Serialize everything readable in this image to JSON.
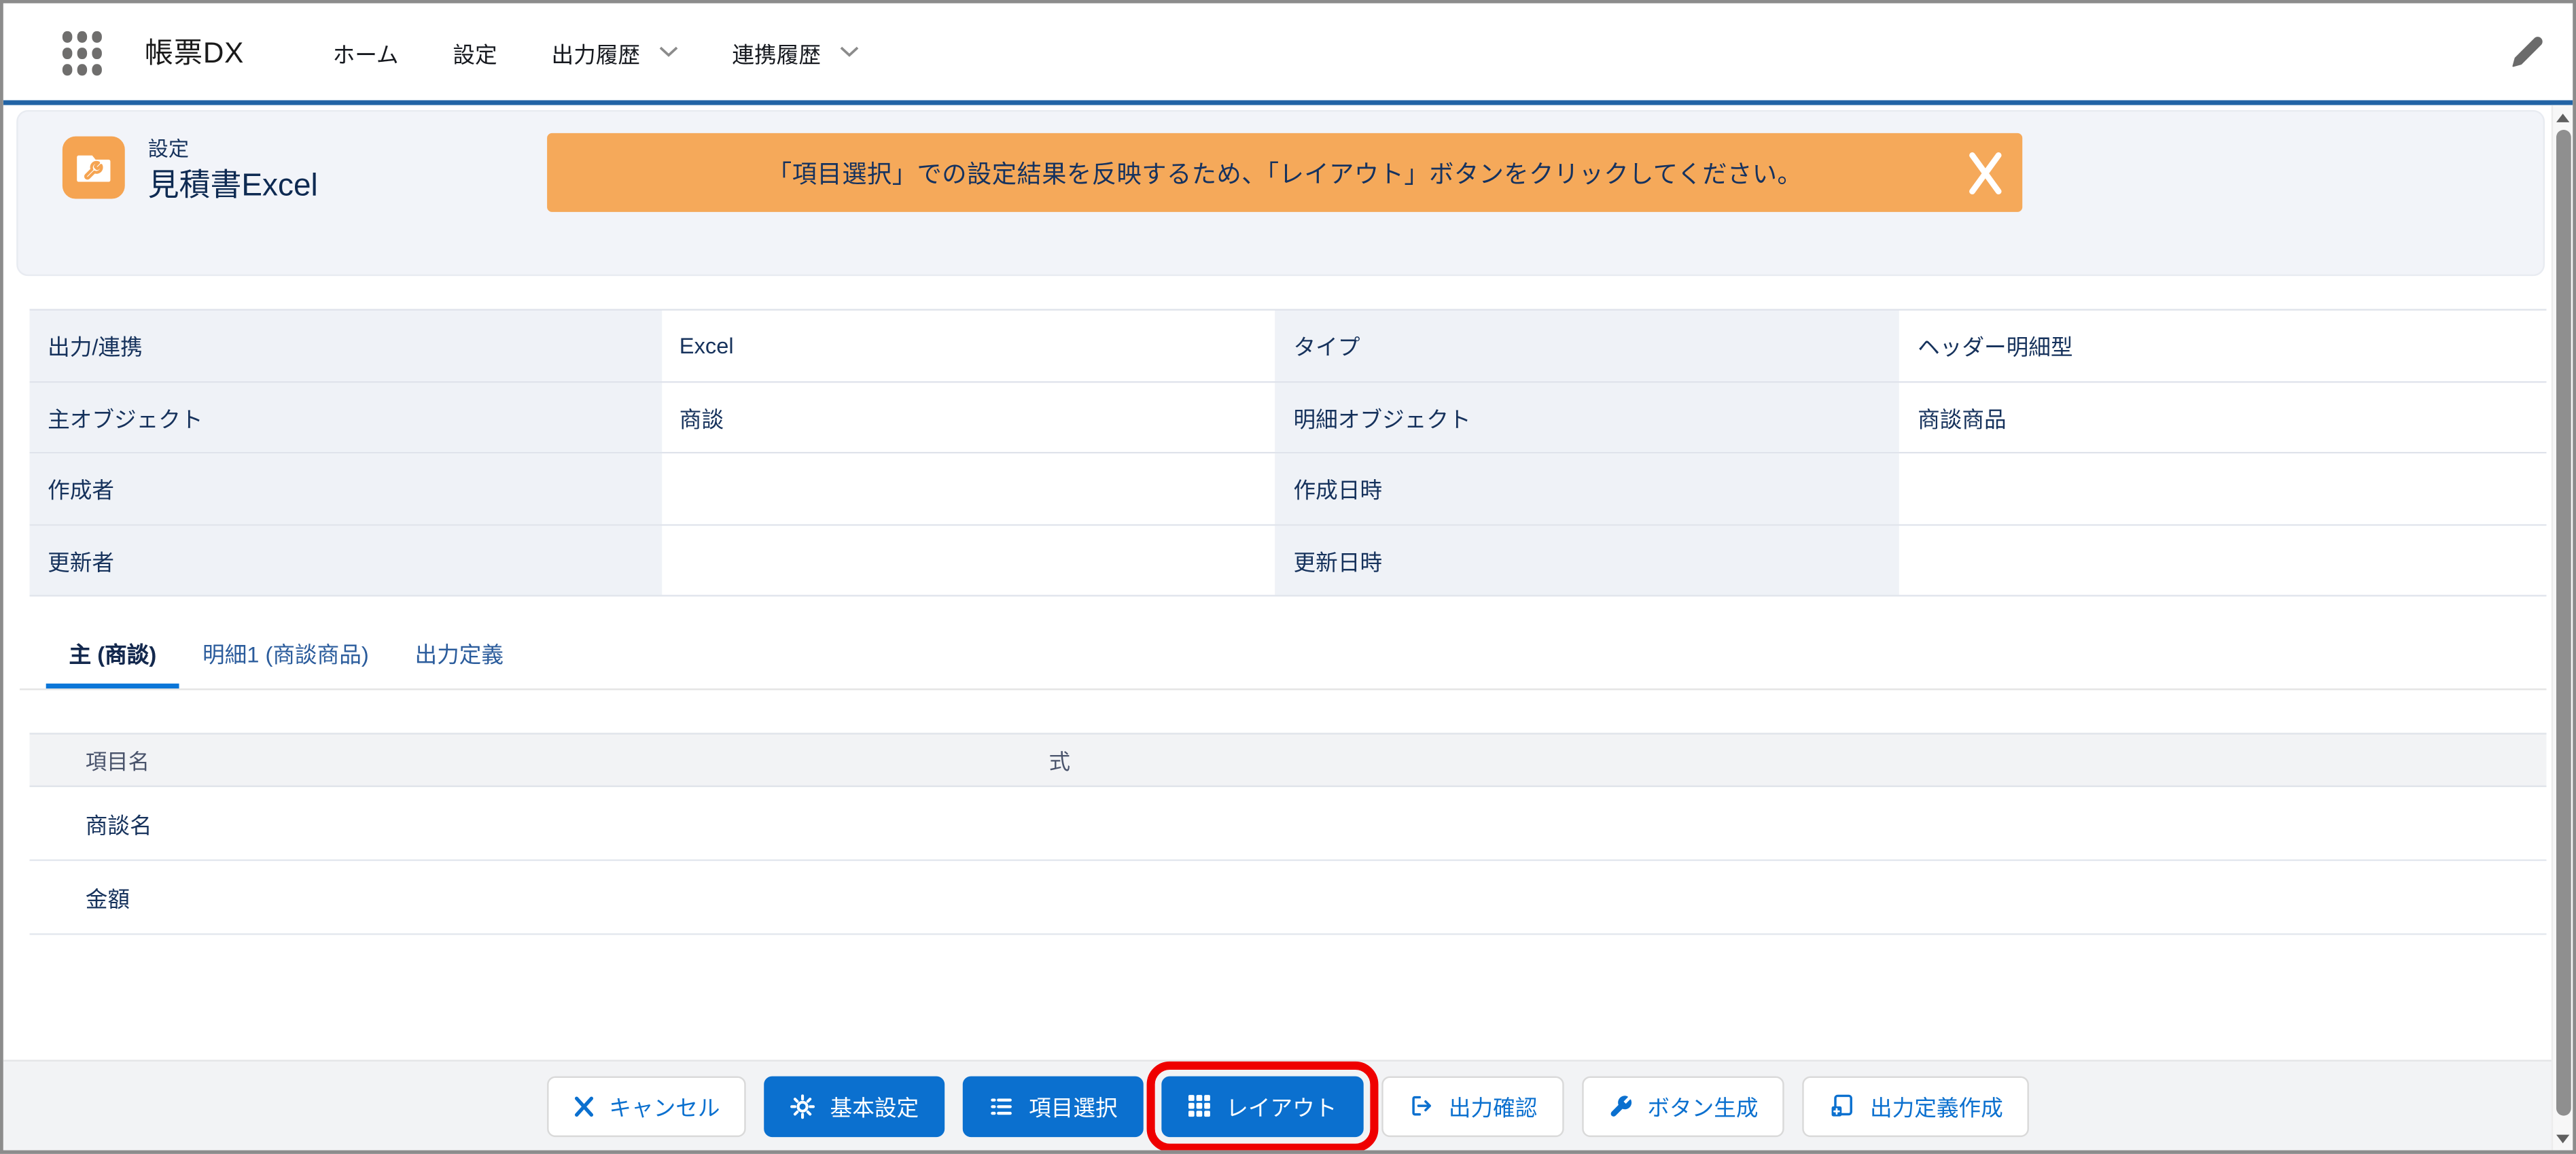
{
  "app": {
    "name": "帳票DX",
    "nav_items": [
      {
        "label": "ホーム",
        "menu": false
      },
      {
        "label": "設定",
        "menu": false
      },
      {
        "label": "出力履歴",
        "menu": true
      },
      {
        "label": "連携履歴",
        "menu": true
      }
    ]
  },
  "header": {
    "record_type": "設定",
    "title": "見積書Excel",
    "icon": "folder-wrench-icon",
    "icon_color": "#f5a452"
  },
  "banner": {
    "message": "「項目選択」での設定結果を反映するため、「レイアウト」ボタンをクリックしてください。",
    "background": "#f5a95a",
    "close_icon": "close-icon"
  },
  "details": {
    "rows": [
      {
        "l1": "出力/連携",
        "v1": "Excel",
        "l2": "タイプ",
        "v2": "ヘッダー明細型"
      },
      {
        "l1": "主オブジェクト",
        "v1": "商談",
        "l2": "明細オブジェクト",
        "v2": "商談商品"
      },
      {
        "l1": "作成者",
        "v1": "",
        "l2": "作成日時",
        "v2": ""
      },
      {
        "l1": "更新者",
        "v1": "",
        "l2": "更新日時",
        "v2": ""
      }
    ]
  },
  "tabs": [
    {
      "label": "主 (商談)",
      "active": true
    },
    {
      "label": "明細1 (商談商品)",
      "active": false
    },
    {
      "label": "出力定義",
      "active": false
    }
  ],
  "field_table": {
    "headers": {
      "name": "項目名",
      "formula": "式"
    },
    "rows": [
      {
        "name": "商談名",
        "formula": ""
      },
      {
        "name": "金額",
        "formula": ""
      }
    ]
  },
  "footer": {
    "buttons": [
      {
        "label": "キャンセル",
        "variant": "neutral",
        "icon": "close-icon",
        "highlighted": false
      },
      {
        "label": "基本設定",
        "variant": "brand",
        "icon": "gear-icon",
        "highlighted": false
      },
      {
        "label": "項目選択",
        "variant": "brand",
        "icon": "list-icon",
        "highlighted": false
      },
      {
        "label": "レイアウト",
        "variant": "brand",
        "icon": "grid-icon",
        "highlighted": true
      },
      {
        "label": "出力確認",
        "variant": "neutral",
        "icon": "export-icon",
        "highlighted": false
      },
      {
        "label": "ボタン生成",
        "variant": "neutral",
        "icon": "wrench-icon",
        "highlighted": false
      },
      {
        "label": "出力定義作成",
        "variant": "neutral",
        "icon": "doc-add-icon",
        "highlighted": false
      }
    ]
  },
  "colors": {
    "brand_blue": "#0b70cf",
    "nav_border_blue": "#2264a5",
    "banner_orange": "#f5a95a",
    "record_icon_orange": "#f5a452",
    "text_navy": "#16325c",
    "tab_active_underline": "#0b76d8",
    "highlight_red": "#ef0000"
  }
}
